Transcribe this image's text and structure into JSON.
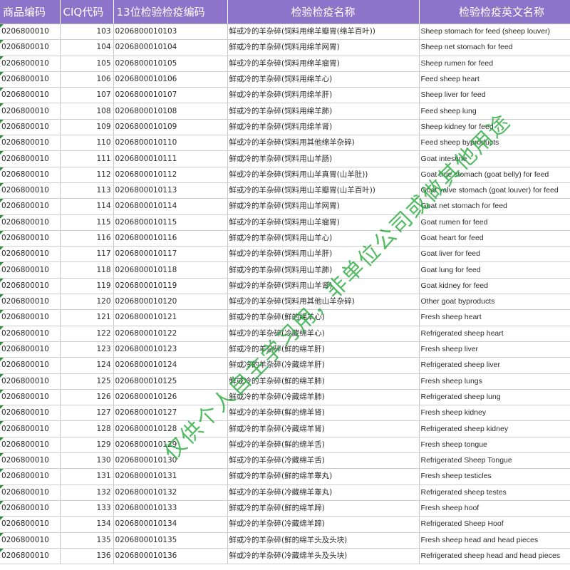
{
  "headers": [
    "商品编码",
    "CIQ代码",
    "13位检验检疫编码",
    "检验检疫名称",
    "检验检疫英文名称"
  ],
  "rows": [
    [
      "0206800010",
      "103",
      "0206800010103",
      "鲜或冷的羊杂碎(饲料用绵羊瓣胃(绵羊百叶))",
      "Sheep stomach for feed (sheep louver)"
    ],
    [
      "0206800010",
      "104",
      "0206800010104",
      "鲜或冷的羊杂碎(饲料用绵羊网胃)",
      "Sheep net stomach for feed"
    ],
    [
      "0206800010",
      "105",
      "0206800010105",
      "鲜或冷的羊杂碎(饲料用绵羊瘤胃)",
      "Sheep rumen for feed"
    ],
    [
      "0206800010",
      "106",
      "0206800010106",
      "鲜或冷的羊杂碎(饲料用绵羊心)",
      "Feed sheep heart"
    ],
    [
      "0206800010",
      "107",
      "0206800010107",
      "鲜或冷的羊杂碎(饲料用绵羊肝)",
      "Sheep liver for feed"
    ],
    [
      "0206800010",
      "108",
      "0206800010108",
      "鲜或冷的羊杂碎(饲料用绵羊肺)",
      "Feed sheep lung"
    ],
    [
      "0206800010",
      "109",
      "0206800010109",
      "鲜或冷的羊杂碎(饲料用绵羊肾)",
      "Sheep kidney for feed"
    ],
    [
      "0206800010",
      "110",
      "0206800010110",
      "鲜或冷的羊杂碎(饲料用其他绵羊杂碎)",
      "Feed sheep byproducts"
    ],
    [
      "0206800010",
      "111",
      "0206800010111",
      "鲜或冷的羊杂碎(饲料用山羊肠)",
      "Goat intestine"
    ],
    [
      "0206800010",
      "112",
      "0206800010112",
      "鲜或冷的羊杂碎(饲料用山羊真胃(山羊肚))",
      "Goat true stomach (goat belly) for feed"
    ],
    [
      "0206800010",
      "113",
      "0206800010113",
      "鲜或冷的羊杂碎(饲料用山羊瓣胃(山羊百叶))",
      "Goat valve stomach (goat louver) for feed"
    ],
    [
      "0206800010",
      "114",
      "0206800010114",
      "鲜或冷的羊杂碎(饲料用山羊网胃)",
      "Goat net stomach for feed"
    ],
    [
      "0206800010",
      "115",
      "0206800010115",
      "鲜或冷的羊杂碎(饲料用山羊瘤胃)",
      "Goat rumen for feed"
    ],
    [
      "0206800010",
      "116",
      "0206800010116",
      "鲜或冷的羊杂碎(饲料用山羊心)",
      "Goat heart for feed"
    ],
    [
      "0206800010",
      "117",
      "0206800010117",
      "鲜或冷的羊杂碎(饲料用山羊肝)",
      "Goat liver for feed"
    ],
    [
      "0206800010",
      "118",
      "0206800010118",
      "鲜或冷的羊杂碎(饲料用山羊肺)",
      "Goat lung for feed"
    ],
    [
      "0206800010",
      "119",
      "0206800010119",
      "鲜或冷的羊杂碎(饲料用山羊肾)",
      "Goat kidney for feed"
    ],
    [
      "0206800010",
      "120",
      "0206800010120",
      "鲜或冷的羊杂碎(饲料用其他山羊杂碎)",
      "Other goat byproducts"
    ],
    [
      "0206800010",
      "121",
      "0206800010121",
      "鲜或冷的羊杂碎(鲜的绵羊心)",
      "Fresh sheep heart"
    ],
    [
      "0206800010",
      "122",
      "0206800010122",
      "鲜或冷的羊杂碎(冷藏绵羊心)",
      "Refrigerated sheep heart"
    ],
    [
      "0206800010",
      "123",
      "0206800010123",
      "鲜或冷的羊杂碎(鲜的绵羊肝)",
      "Fresh sheep liver"
    ],
    [
      "0206800010",
      "124",
      "0206800010124",
      "鲜或冷的羊杂碎(冷藏绵羊肝)",
      "Refrigerated sheep liver"
    ],
    [
      "0206800010",
      "125",
      "0206800010125",
      "鲜或冷的羊杂碎(鲜的绵羊肺)",
      "Fresh sheep lungs"
    ],
    [
      "0206800010",
      "126",
      "0206800010126",
      "鲜或冷的羊杂碎(冷藏绵羊肺)",
      "Refrigerated sheep lung"
    ],
    [
      "0206800010",
      "127",
      "0206800010127",
      "鲜或冷的羊杂碎(鲜的绵羊肾)",
      "Fresh sheep kidney"
    ],
    [
      "0206800010",
      "128",
      "0206800010128",
      "鲜或冷的羊杂碎(冷藏绵羊肾)",
      "Refrigerated sheep kidney"
    ],
    [
      "0206800010",
      "129",
      "0206800010129",
      "鲜或冷的羊杂碎(鲜的绵羊舌)",
      "Fresh sheep tongue"
    ],
    [
      "0206800010",
      "130",
      "0206800010130",
      "鲜或冷的羊杂碎(冷藏绵羊舌)",
      "Refrigerated Sheep Tongue"
    ],
    [
      "0206800010",
      "131",
      "0206800010131",
      "鲜或冷的羊杂碎(鲜的绵羊睾丸)",
      "Fresh sheep testicles"
    ],
    [
      "0206800010",
      "132",
      "0206800010132",
      "鲜或冷的羊杂碎(冷藏绵羊睾丸)",
      "Refrigerated sheep testes"
    ],
    [
      "0206800010",
      "133",
      "0206800010133",
      "鲜或冷的羊杂碎(鲜的绵羊蹄)",
      "Fresh sheep hoof"
    ],
    [
      "0206800010",
      "134",
      "0206800010134",
      "鲜或冷的羊杂碎(冷藏绵羊蹄)",
      "Refrigerated Sheep Hoof"
    ],
    [
      "0206800010",
      "135",
      "0206800010135",
      "鲜或冷的羊杂碎(鲜的绵羊头及头块)",
      "Fresh sheep head and head pieces"
    ],
    [
      "0206800010",
      "136",
      "0206800010136",
      "鲜或冷的羊杂碎(冷藏绵羊头及头块)",
      "Refrigerated sheep head and head pieces"
    ]
  ],
  "watermark": "仅供个人自主学习用，非单位公司或做其他用途",
  "colors": {
    "header_bg": "#8d73c9",
    "header_text": "#ffffff",
    "watermark": "#28aa3c",
    "cell_marker": "#2e8b3b"
  }
}
